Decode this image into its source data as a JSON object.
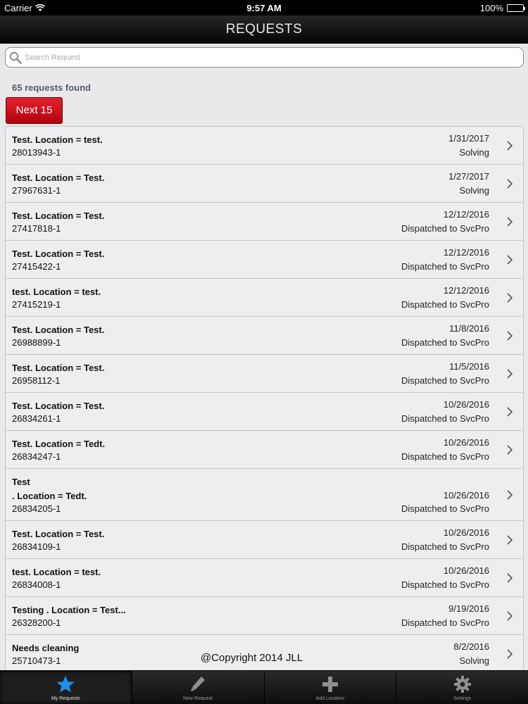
{
  "status_bar": {
    "carrier": "Carrier",
    "time": "9:57 AM",
    "battery": "100%"
  },
  "header": {
    "title": "REQUESTS"
  },
  "search": {
    "placeholder": "Search Request",
    "value": ""
  },
  "summary": {
    "count_text": "65 requests found",
    "next_label": "Next 15"
  },
  "requests": [
    {
      "title": "Test. Location = test.",
      "id": "28013943-1",
      "date": "1/31/2017",
      "status": "Solving"
    },
    {
      "title": "Test. Location = Test.",
      "id": "27967631-1",
      "date": "1/27/2017",
      "status": "Solving"
    },
    {
      "title": "Test. Location = Test.",
      "id": "27417818-1",
      "date": "12/12/2016",
      "status": "Dispatched to SvcPro"
    },
    {
      "title": "Test. Location = Test.",
      "id": "27415422-1",
      "date": "12/12/2016",
      "status": "Dispatched to SvcPro"
    },
    {
      "title": "test. Location = test.",
      "id": "27415219-1",
      "date": "12/12/2016",
      "status": "Dispatched to SvcPro"
    },
    {
      "title": "Test. Location = Test.",
      "id": "26988899-1",
      "date": "11/8/2016",
      "status": "Dispatched to SvcPro"
    },
    {
      "title": "Test. Location = Test.",
      "id": "26958112-1",
      "date": "11/5/2016",
      "status": "Dispatched to SvcPro"
    },
    {
      "title": "Test. Location = Test.",
      "id": "26834261-1",
      "date": "10/26/2016",
      "status": "Dispatched to SvcPro"
    },
    {
      "title": "Test. Location = Tedt.",
      "id": "26834247-1",
      "date": "10/26/2016",
      "status": "Dispatched to SvcPro"
    },
    {
      "title": "Test\n. Location = Tedt.",
      "id": "26834205-1",
      "date": "10/26/2016",
      "status": "Dispatched to SvcPro"
    },
    {
      "title": "Test. Location = Test.",
      "id": "26834109-1",
      "date": "10/26/2016",
      "status": "Dispatched to SvcPro"
    },
    {
      "title": "test. Location = test.",
      "id": "26834008-1",
      "date": "10/26/2016",
      "status": "Dispatched to SvcPro"
    },
    {
      "title": "Testing . Location = Test...",
      "id": "26328200-1",
      "date": "9/19/2016",
      "status": "Dispatched to SvcPro"
    },
    {
      "title": "Needs cleaning",
      "id": "25710473-1",
      "date": "8/2/2016",
      "status": "Solving"
    }
  ],
  "footer": {
    "copyright": "@Copyright 2014 JLL"
  },
  "tabs": [
    {
      "label": "My Requests",
      "icon": "star-icon",
      "active": true
    },
    {
      "label": "New Request",
      "icon": "pencil-icon",
      "active": false
    },
    {
      "label": "Add Location",
      "icon": "plus-icon",
      "active": false
    },
    {
      "label": "Settings",
      "icon": "gear-icon",
      "active": false
    }
  ]
}
